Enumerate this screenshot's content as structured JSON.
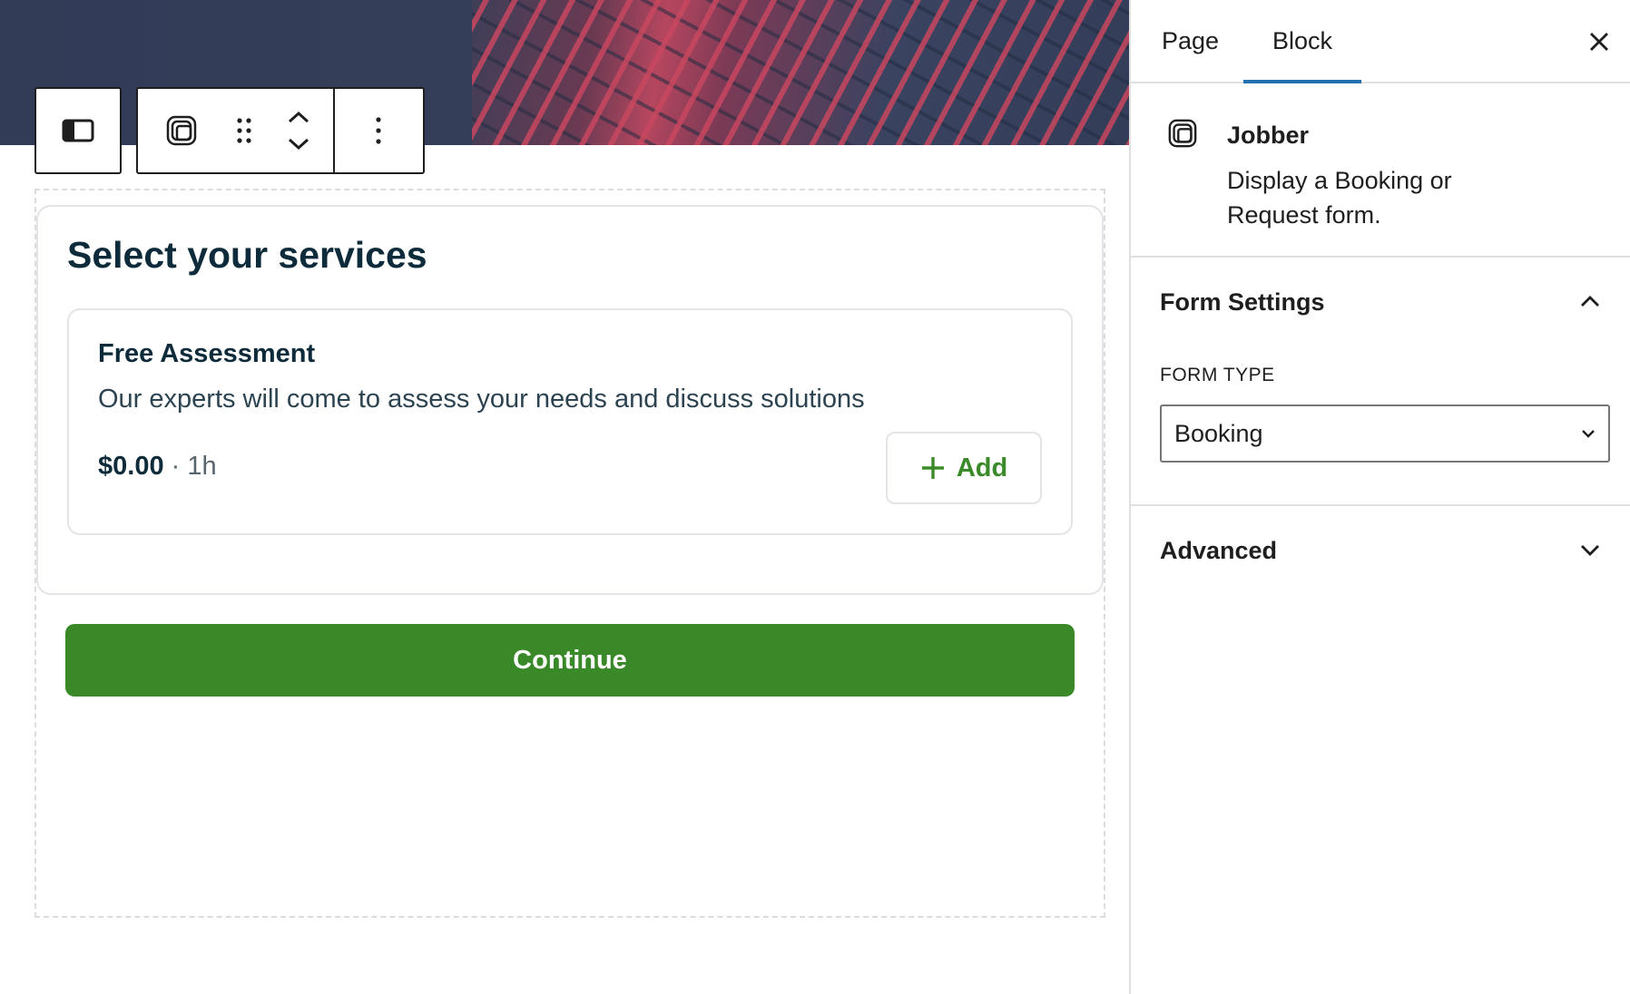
{
  "editor": {
    "services": {
      "title": "Select your services",
      "items": [
        {
          "name": "Free Assessment",
          "description": "Our experts will come to assess your needs and discuss solutions",
          "price": "$0.00",
          "separator": " · ",
          "duration": "1h",
          "add_label": "Add"
        }
      ],
      "continue_label": "Continue"
    },
    "toolbar": {
      "icons": [
        "sidebar-toggle-icon",
        "jobber-block-icon",
        "drag-handle-icon",
        "move-up-icon",
        "move-down-icon",
        "more-options-icon"
      ]
    },
    "colors": {
      "accent_green": "#3a8928",
      "heading_navy": "#0d2b3a",
      "tab_indicator": "#2271b1"
    }
  },
  "sidebar": {
    "tabs": [
      {
        "label": "Page",
        "active": false
      },
      {
        "label": "Block",
        "active": true
      }
    ],
    "close_icon": "close-icon",
    "block_card": {
      "icon": "jobber-block-icon",
      "title": "Jobber",
      "description": "Display a Booking or Request form."
    },
    "panels": {
      "form_settings": {
        "title": "Form Settings",
        "expanded": true,
        "form_type_label": "FORM TYPE",
        "form_type_value": "Booking"
      },
      "advanced": {
        "title": "Advanced",
        "expanded": false
      }
    }
  }
}
